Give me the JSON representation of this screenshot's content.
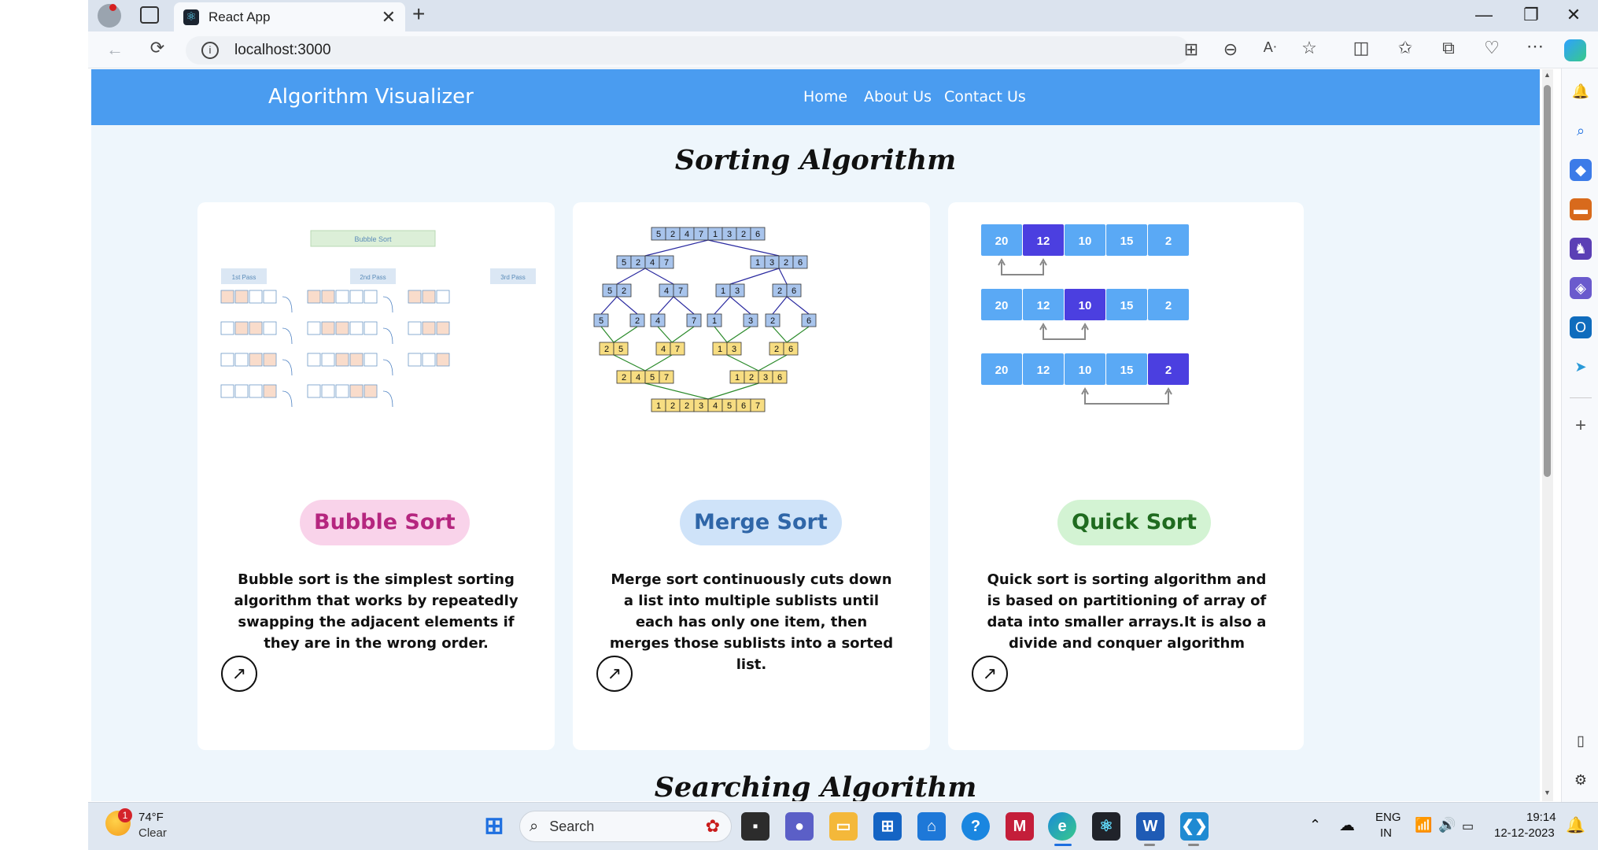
{
  "browser": {
    "tab_title": "React App",
    "tab_close": "✕",
    "new_tab": "+",
    "url": "localhost:3000",
    "window": {
      "minimize": "—",
      "restore": "❐",
      "close": "✕"
    }
  },
  "page": {
    "brand": "Algorithm Visualizer",
    "nav": [
      "Home",
      "About Us",
      "Contact Us"
    ],
    "sections": [
      {
        "title": "Sorting Algorithm",
        "cards": [
          {
            "name": "Bubble Sort",
            "description": "Bubble sort is the simplest sorting algorithm that works by repeatedly swapping the adjacent elements if they are in the wrong order.",
            "pill_bg": "#f9d3ea",
            "pill_color": "#b5267f",
            "image": {
              "header": "Bubble Sort",
              "passes": [
                "1st Pass",
                "2nd Pass",
                "3rd Pass"
              ]
            }
          },
          {
            "name": "Merge Sort",
            "description": "Merge sort continuously cuts down a list into multiple sublists until each has only one item, then merges those sublists into a sorted list.",
            "pill_bg": "#cfe3f9",
            "pill_color": "#2f66a8",
            "image": {
              "top": [
                5,
                2,
                4,
                7,
                1,
                3,
                2,
                6
              ],
              "level1": [
                [
                  5,
                  2,
                  4,
                  7
                ],
                [
                  1,
                  3,
                  2,
                  6
                ]
              ],
              "level2": [
                [
                  5,
                  2
                ],
                [
                  4,
                  7
                ],
                [
                  1,
                  3
                ],
                [
                  2,
                  6
                ]
              ],
              "level3": [
                5,
                2,
                4,
                7,
                1,
                3,
                2,
                6
              ],
              "merge1": [
                [
                  2,
                  5
                ],
                [
                  4,
                  7
                ],
                [
                  1,
                  3
                ],
                [
                  2,
                  6
                ]
              ],
              "merge2": [
                [
                  2,
                  4,
                  5,
                  7
                ],
                [
                  1,
                  2,
                  3,
                  6
                ]
              ],
              "result": [
                1,
                2,
                2,
                3,
                4,
                5,
                6,
                7
              ]
            }
          },
          {
            "name": "Quick Sort",
            "description": "Quick sort is sorting algorithm and is based on partitioning of array of data into smaller arrays.It is also a divide and conquer algorithm",
            "pill_bg": "#d3f3d3",
            "pill_color": "#1f6b1f",
            "image": {
              "rows": [
                {
                  "values": [
                    20,
                    12,
                    10,
                    15,
                    2
                  ],
                  "pivot_index": 1
                },
                {
                  "values": [
                    20,
                    12,
                    10,
                    15,
                    2
                  ],
                  "pivot_index": 2
                },
                {
                  "values": [
                    20,
                    12,
                    10,
                    15,
                    2
                  ],
                  "pivot_index": 4
                }
              ]
            }
          }
        ]
      },
      {
        "title": "Searching Algorithm"
      }
    ],
    "card_link_icon": "↗"
  },
  "taskbar": {
    "weather": {
      "temp": "74°F",
      "condition": "Clear",
      "badge": "1"
    },
    "search": "Search",
    "lang": "ENG",
    "region": "IN",
    "time": "19:14",
    "date": "12-12-2023"
  },
  "colors": {
    "navbar": "#4a9cf0",
    "page_bg": "#eef6fc",
    "qs_cell": "#5aa9f5",
    "qs_pivot": "#4b3fe0",
    "ms_split": "#a8c4ec",
    "ms_merge": "#f7dd82"
  }
}
